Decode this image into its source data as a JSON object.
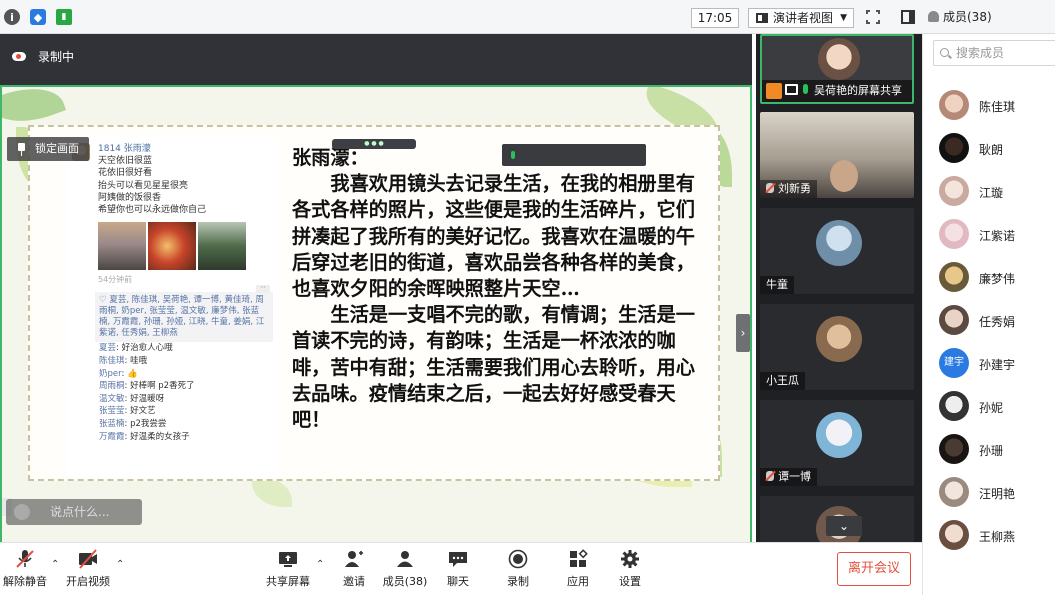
{
  "topbar": {
    "time": "17:05",
    "view_mode": "演讲者视图",
    "members_label": "成员(38)"
  },
  "recording": {
    "label": "录制中"
  },
  "share": {
    "lock_label": "锁定画面",
    "chat": {
      "sender": "1814 张雨濛",
      "lines": [
        "天空依旧很蓝",
        "花依旧很好看",
        "抬头可以看见星星很亮",
        "阿姨做的饭很香",
        "希望你也可以永远做你自己"
      ],
      "time": "54分钟前",
      "likes": "♡ 夏芸, 陈佳琪, 吴荷艳, 谭一博, 黄佳琦, 周雨桐, 奶per, 张莹莹, 温文敏, 廉梦伟, 张蓝楠, 万霞霞, 孙珊, 孙娅, 江晓, 牛童, 姜娟, 江紫诺, 任秀娟, 王柳燕",
      "comments": [
        {
          "name": "夏芸",
          "text": ": 好治愈人心哦"
        },
        {
          "name": "陈佳琪",
          "text": ": 哇哦"
        },
        {
          "name": "奶per",
          "text": ": 👍"
        },
        {
          "name": "周雨桐",
          "text": ": 好棒啊 p2香死了"
        },
        {
          "name": "温文敏",
          "text": ": 好温暖呀"
        },
        {
          "name": "张莹莹",
          "text": ": 好文艺"
        },
        {
          "name": "张蓝楠",
          "text": ": p2我尝尝"
        },
        {
          "name": "万霞霞",
          "text": ": 好温柔的女孩子"
        }
      ]
    },
    "essay": {
      "heading": "张雨濛：",
      "p1": "我喜欢用镜头去记录生活，在我的相册里有各式各样的照片，这些便是我的生活碎片，它们拼凑起了我所有的美好记忆。我喜欢在温暖的午后穿过老旧的街道，喜欢品尝各种各样的美食，也喜欢夕阳的余晖映照整片天空…",
      "p2": "生活是一支唱不完的歌，有情调；生活是一首读不完的诗，有韵味；生活是一杯浓浓的咖啡，苦中有甜；生活需要我们用心去聆听，用心去品味。疫情结束之后，一起去好好感受春天吧！"
    },
    "chat_input_placeholder": "说点什么..."
  },
  "videos": [
    {
      "name": "吴荷艳的屏幕共享"
    },
    {
      "name": "刘新勇"
    },
    {
      "name": "牛童"
    },
    {
      "name": "小王瓜"
    },
    {
      "name": "谭一博"
    }
  ],
  "members": {
    "search_placeholder": "搜索成员",
    "list": [
      "陈佳琪",
      "耿朗",
      "江璇",
      "江紫诺",
      "廉梦伟",
      "任秀娟",
      "孙建宇",
      "孙妮",
      "孙珊",
      "汪明艳",
      "王柳燕"
    ],
    "badge_text": "建宇"
  },
  "toolbar": {
    "unmute": "解除静音",
    "start_video": "开启视频",
    "share_screen": "共享屏幕",
    "invite": "邀请",
    "members": "成员(38)",
    "chat": "聊天",
    "record": "录制",
    "apps": "应用",
    "settings": "设置",
    "leave": "离开会议"
  },
  "colors": {
    "accent_green": "#3fb76b",
    "leave_red": "#e4503f",
    "link_blue": "#2a7ae2"
  }
}
